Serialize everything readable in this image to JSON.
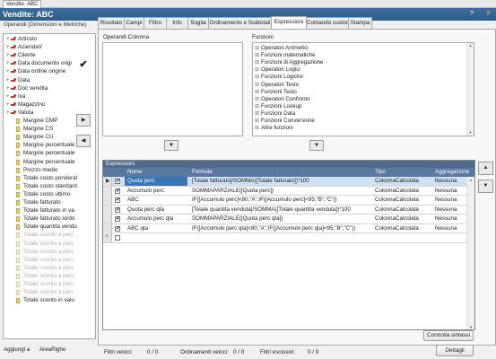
{
  "window_tab": "Vendite: ABC",
  "title": "Vendite: ABC",
  "window_controls": [
    "?",
    "F"
  ],
  "left_panel": {
    "header": "Operandi (Dimensioni e Metriche)",
    "tree": [
      {
        "label": "Articolo",
        "kind": "branch",
        "dim": false
      },
      {
        "label": "AziendaV",
        "kind": "branch",
        "dim": false
      },
      {
        "label": "Cliente",
        "kind": "branch",
        "dim": false
      },
      {
        "label": "Data documento origi",
        "kind": "branch",
        "dim": false
      },
      {
        "label": "Data ordine origine",
        "kind": "branch",
        "dim": false
      },
      {
        "label": "Data",
        "kind": "branch",
        "dim": false
      },
      {
        "label": "Doc vendita",
        "kind": "branch",
        "dim": false
      },
      {
        "label": "Iva",
        "kind": "branch",
        "dim": false
      },
      {
        "label": "Magazzino",
        "kind": "branch",
        "dim": false
      },
      {
        "label": "Valuta",
        "kind": "branch",
        "dim": false
      },
      {
        "label": "Margine CMP",
        "kind": "leaf",
        "dim": false
      },
      {
        "label": "Margine CS",
        "kind": "leaf",
        "dim": false
      },
      {
        "label": "Margine CU",
        "kind": "leaf",
        "dim": false
      },
      {
        "label": "Margine percentuale",
        "kind": "leaf",
        "dim": false
      },
      {
        "label": "Margine percentuale",
        "kind": "leaf",
        "dim": false
      },
      {
        "label": "Margine percentuale",
        "kind": "leaf",
        "dim": false
      },
      {
        "label": "Prezzo medio",
        "kind": "leaf",
        "dim": false
      },
      {
        "label": "Totale costo ponderat",
        "kind": "leaf",
        "dim": false
      },
      {
        "label": "Totale costo standard",
        "kind": "leaf",
        "dim": false
      },
      {
        "label": "Totale costo ultimo",
        "kind": "leaf",
        "dim": false
      },
      {
        "label": "Totale fatturato",
        "kind": "leaf",
        "dim": false
      },
      {
        "label": "Totale fatturato in va",
        "kind": "leaf",
        "dim": false
      },
      {
        "label": "Totale fatturato lordo",
        "kind": "leaf",
        "dim": false
      },
      {
        "label": "Totale quantita vendu",
        "kind": "leaf",
        "dim": false
      },
      {
        "label": "Totale sconto a perc",
        "kind": "leaf",
        "dim": true
      },
      {
        "label": "Totale sconto a perc",
        "kind": "leaf",
        "dim": true
      },
      {
        "label": "Totale sconto a perc",
        "kind": "leaf",
        "dim": true
      },
      {
        "label": "Totale sconto a perc",
        "kind": "leaf",
        "dim": true
      },
      {
        "label": "Totale sconto a perc",
        "kind": "leaf",
        "dim": true
      },
      {
        "label": "Totale sconto a perc",
        "kind": "leaf",
        "dim": true
      },
      {
        "label": "Totale sconto a perc",
        "kind": "leaf",
        "dim": true
      },
      {
        "label": "Totale sconto a perc",
        "kind": "leaf",
        "dim": true
      },
      {
        "label": "Totale sconto in valu",
        "kind": "leaf",
        "dim": false
      }
    ],
    "footer_add": "Aggiungi a",
    "footer_target": "AreaRighe"
  },
  "tabs": [
    "Risultato",
    "Campi",
    "Filtro",
    "Info",
    "Soglia",
    "Ordinamento e Subtotali",
    "Espressioni",
    "Comando custom",
    "Stampa"
  ],
  "active_tab": "Espressioni",
  "operandi_colonna_label": "Operandi Colonna",
  "funzioni_label": "Funzioni",
  "funzioni": [
    "Operatori Aritmetici",
    "Funzioni matematiche",
    "Funzioni di Aggregazione",
    "Operatori Logici",
    "Funzioni Logiche",
    "Operatori Testo",
    "Funzioni Testo",
    "Operatori Confronto",
    "Funzioni Lookup",
    "Funzioni Data",
    "Funzioni Conversione",
    "Altre funzioni"
  ],
  "grid": {
    "title": "Espressioni",
    "headers": {
      "nome": "Nome",
      "formula": "Formula",
      "tipo": "Tipo",
      "aggregazione": "Aggregazione"
    },
    "rows": [
      {
        "nome": "Quota perc",
        "formula": "[Totale fatturato]/SOMMA([Totale fatturato])*100",
        "tipo": "ColonnaCalcolata",
        "aggregazione": "Nessuna",
        "selected": true
      },
      {
        "nome": "Accumulo perc",
        "formula": "SOMMAPARZIALE([Quota perc])",
        "tipo": "ColonnaCalcolata",
        "aggregazione": "Nessuna",
        "selected": false
      },
      {
        "nome": "ABC",
        "formula": "IF([Accumulo perc]<80,\"A\",IF([Accumulo perc]<95,\"B\",\"C\"))",
        "tipo": "ColonnaCalcolata",
        "aggregazione": "Nessuna",
        "selected": false
      },
      {
        "nome": "Quota perc qta",
        "formula": "[Totale quantita venduta]/SOMMA([Totale quantita venduta])*100",
        "tipo": "ColonnaCalcolata",
        "aggregazione": "Nessuna",
        "selected": false
      },
      {
        "nome": "Accumulo perc qta",
        "formula": "SOMMAPARZIALE([Quota perc qta])",
        "tipo": "ColonnaCalcolata",
        "aggregazione": "Nessuna",
        "selected": false
      },
      {
        "nome": "ABC qta",
        "formula": "IF([Accumulo perc qta]<80,\"A\",IF([Accumulo perc qta]<95,\"B\",\"C\"))",
        "tipo": "ColonnaCalcolata",
        "aggregazione": "Nessuna",
        "selected": false
      }
    ]
  },
  "buttons": {
    "check_syntax": "Controlla sintassi",
    "details": "Dettagli"
  },
  "footer": {
    "filtri_veloci": "Filtri veloci:",
    "filtri_veloci_val": "0 / 0",
    "ordinamenti_veloci": "Ordinamenti veloci:",
    "ordinamenti_veloci_val": "0 / 0",
    "filtri_esclusivi": "Filtri esclusivi:",
    "filtri_esclusivi_val": "0 / 0"
  }
}
